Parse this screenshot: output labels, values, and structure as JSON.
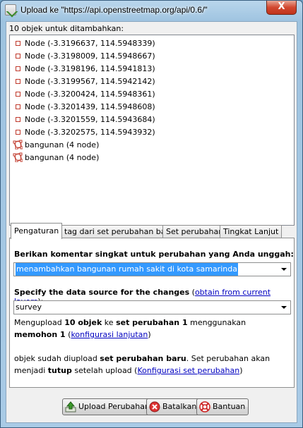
{
  "window": {
    "title": "Upload ke \"https://api.openstreetmap.org/api/0.6/\"",
    "close_label": "X"
  },
  "objects": {
    "label": "10 objek untuk ditambahkan:",
    "items": [
      {
        "type": "node",
        "text": "Node (-3.3196637, 114.5948339)"
      },
      {
        "type": "node",
        "text": "Node (-3.3198009, 114.5948667)"
      },
      {
        "type": "node",
        "text": "Node (-3.3198196, 114.5941813)"
      },
      {
        "type": "node",
        "text": "Node (-3.3199567, 114.5942142)"
      },
      {
        "type": "node",
        "text": "Node (-3.3200424, 114.5948361)"
      },
      {
        "type": "node",
        "text": "Node (-3.3201439, 114.5948608)"
      },
      {
        "type": "node",
        "text": "Node (-3.3201559, 114.5943684)"
      },
      {
        "type": "node",
        "text": "Node (-3.3202575, 114.5943932)"
      },
      {
        "type": "way",
        "text": "bangunan (4 node)"
      },
      {
        "type": "way",
        "text": "bangunan (4 node)"
      }
    ]
  },
  "tabs": [
    {
      "label": "Pengaturan",
      "active": true
    },
    {
      "label": "tag dari set perubahan baru",
      "active": false
    },
    {
      "label": "Set perubahan",
      "active": false
    },
    {
      "label": "Tingkat Lanjut",
      "active": false
    }
  ],
  "settings": {
    "comment_label": "Berikan komentar singkat untuk perubahan yang Anda unggah:",
    "comment_value": "menambahkan bangunan rumah sakit di kota samarinda",
    "source_label": "Specify the data source for the changes",
    "source_link": "obtain from current layers",
    "source_open": "(",
    "source_close": "):",
    "source_value": "survey",
    "upload_info": {
      "t1": "Mengupload ",
      "b1": "10 objek",
      "t2": " ke ",
      "b2": "set perubahan 1",
      "t3": " menggunakan ",
      "b3": "memohon 1",
      "t4": " (",
      "link": "konfigurasi lanjutan",
      "t5": ")"
    },
    "changeset_info": {
      "t1": "objek sudah diupload ",
      "b1": "set perubahan baru",
      "t2": ". Set perubahan akan menjadi ",
      "b2": "tutup",
      "t3": " setelah upload (",
      "link": "Konfigurasi set perubahan",
      "t4": ")"
    }
  },
  "buttons": {
    "upload": "Upload Perubahan",
    "cancel": "Batalkan",
    "help": "Bantuan"
  }
}
